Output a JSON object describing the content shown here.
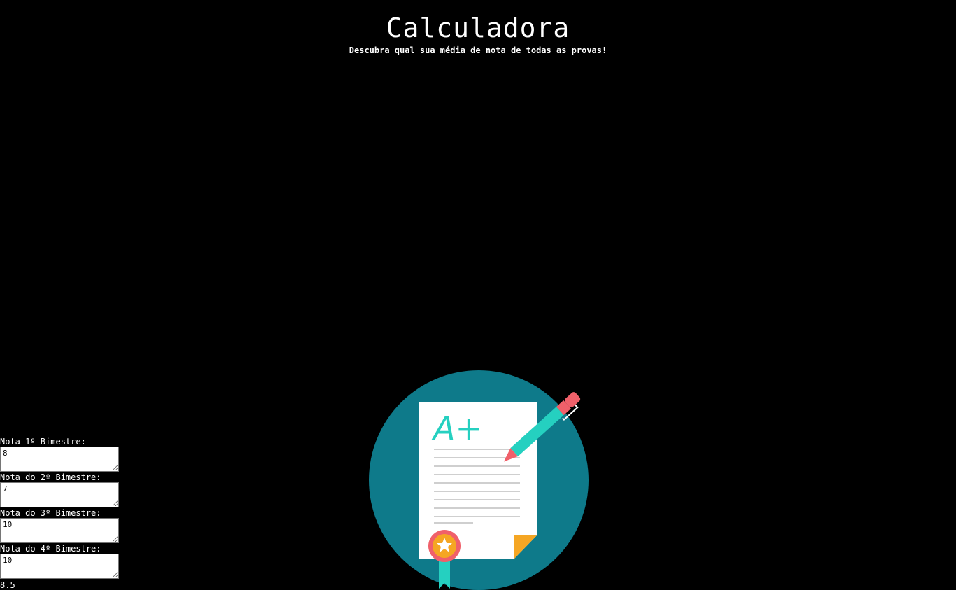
{
  "header": {
    "title": "Calculadora",
    "subtitle": "Descubra qual sua média de nota de todas as provas!"
  },
  "illustration": {
    "grade_text": "A+",
    "colors": {
      "circle": "#0e7a8a",
      "paper": "#ffffff",
      "accent_teal": "#25d0c0",
      "pen_red": "#f0606a",
      "fold_orange": "#f5a623",
      "lines": "#cfcfcf"
    },
    "icons": [
      "paper-icon",
      "pen-icon",
      "award-ribbon-icon",
      "star-icon"
    ]
  },
  "form": {
    "fields": [
      {
        "label": "Nota 1º Bimestre:",
        "value": "8"
      },
      {
        "label": "Nota do 2º Bimestre:",
        "value": "7"
      },
      {
        "label": "Nota do 3º Bimestre:",
        "value": "10"
      },
      {
        "label": "Nota do 4º Bimestre:",
        "value": "10"
      }
    ],
    "result": "8.5"
  }
}
